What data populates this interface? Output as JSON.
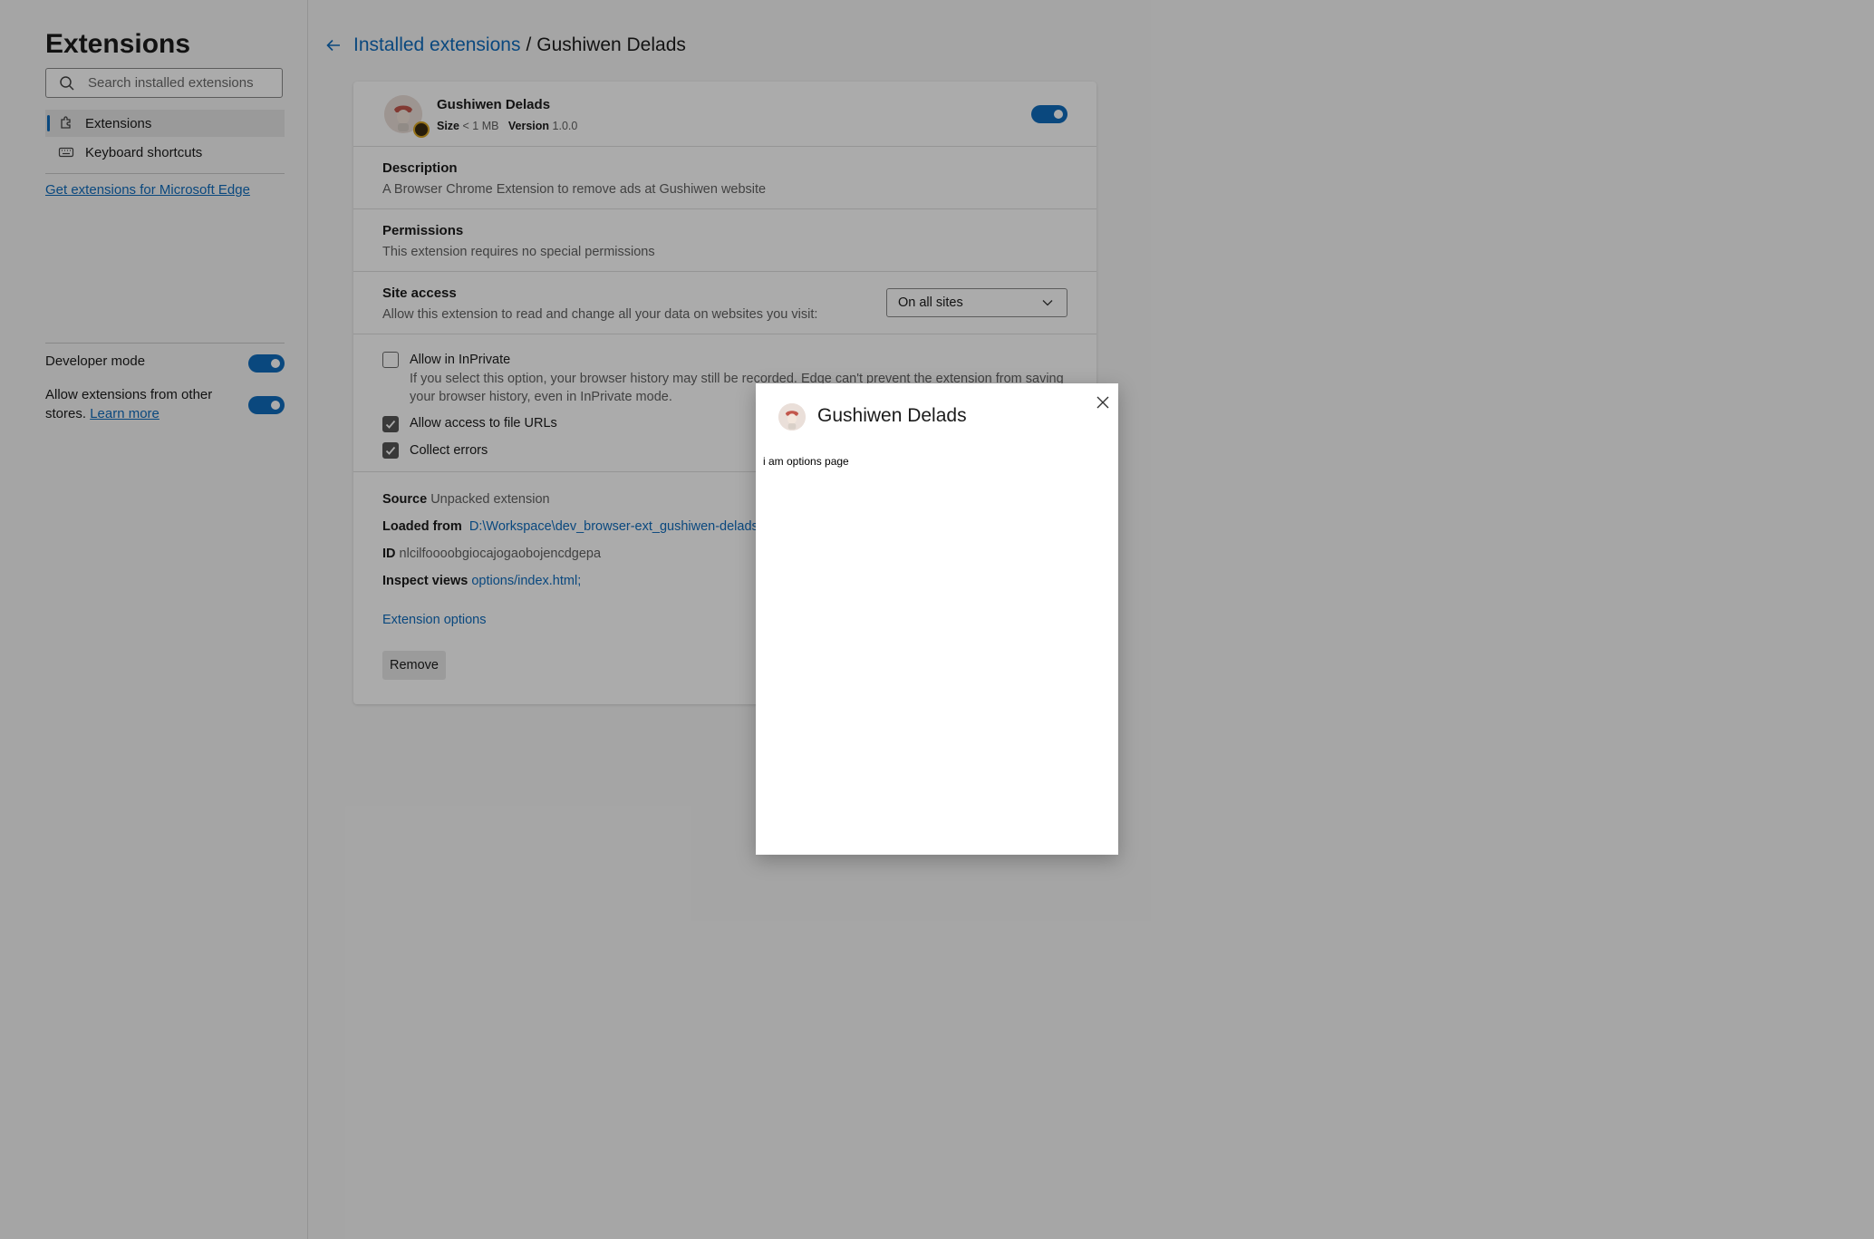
{
  "sidebar": {
    "title": "Extensions",
    "search_placeholder": "Search installed extensions",
    "nav": [
      {
        "label": "Extensions",
        "icon": "puzzle-icon",
        "active": true
      },
      {
        "label": "Keyboard shortcuts",
        "icon": "keyboard-icon",
        "active": false
      }
    ],
    "get_extensions_link": "Get extensions for Microsoft Edge",
    "developer_mode_label": "Developer mode",
    "developer_mode_on": true,
    "allow_other_stores_label": "Allow extensions from other stores.",
    "learn_more": "Learn more",
    "allow_other_stores_on": true
  },
  "breadcrumb": {
    "parent": "Installed extensions",
    "separator": "/",
    "current": "Gushiwen Delads"
  },
  "extension": {
    "name": "Gushiwen Delads",
    "size_label": "Size",
    "size_value": "< 1 MB",
    "version_label": "Version",
    "version_value": "1.0.0",
    "enabled": true,
    "description_title": "Description",
    "description_text": "A Browser Chrome Extension to remove ads at Gushiwen website",
    "permissions_title": "Permissions",
    "permissions_text": "This extension requires no special permissions",
    "site_access_title": "Site access",
    "site_access_text": "Allow this extension to read and change all your data on websites you visit:",
    "site_access_value": "On all sites",
    "options": [
      {
        "label": "Allow in InPrivate",
        "checked": false,
        "desc": "If you select this option, your browser history may still be recorded. Edge can't prevent the extension from saving your browser history, even in InPrivate mode."
      },
      {
        "label": "Allow access to file URLs",
        "checked": true
      },
      {
        "label": "Collect errors",
        "checked": true
      }
    ],
    "source_label": "Source",
    "source_value": "Unpacked extension",
    "loaded_from_label": "Loaded from",
    "loaded_from_value": "D:\\Workspace\\dev_browser-ext_gushiwen-delads",
    "id_label": "ID",
    "id_value": "nlcilfoooobgiocajogaobojencdgepa",
    "inspect_label": "Inspect views",
    "inspect_value": "options/index.html;",
    "extension_options": "Extension options",
    "remove_label": "Remove"
  },
  "dialog": {
    "title": "Gushiwen Delads",
    "body": "i am options page"
  },
  "colors": {
    "accent": "#0f6cbd",
    "overlay": "rgba(0,0,0,0.33)"
  }
}
